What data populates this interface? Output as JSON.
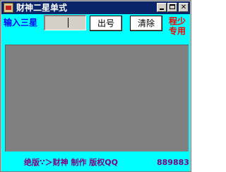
{
  "window": {
    "title": "财神二星单式",
    "icon": "app-icon",
    "controls": {
      "minimize": "minimize-icon",
      "maximize": "maximize-icon",
      "close": "close-icon"
    }
  },
  "toolbar": {
    "input_label": "输入三星",
    "input_value": "",
    "draw_button": "出号",
    "clear_button": "清除",
    "side_note_line1": "程少",
    "side_note_line2": "专用"
  },
  "results": {
    "text": ""
  },
  "footer": {
    "credit": "绝版∵＞财神  制作  版权QQ",
    "qq": "889883"
  },
  "colors": {
    "client_bg": "#00ffff",
    "title_bg": "#0a246a",
    "label_blue": "#0000ff",
    "note_red": "#ff0000",
    "footer_purple": "#800080",
    "result_bg": "#808080"
  }
}
